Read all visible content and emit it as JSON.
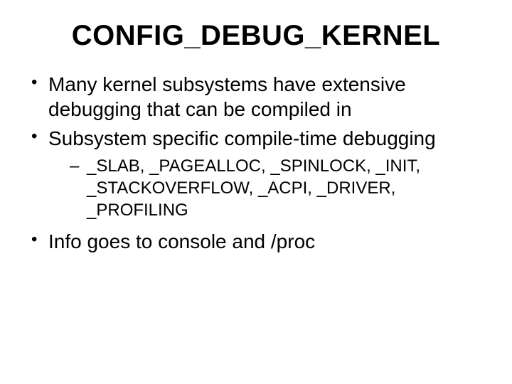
{
  "title": "CONFIG_DEBUG_KERNEL",
  "bullets": {
    "b1": "Many kernel subsystems have extensive debugging that can be compiled in",
    "b2": "Subsystem specific compile-time debugging",
    "b2_sub1": "_SLAB, _PAGEALLOC, _SPINLOCK, _INIT, _STACKOVERFLOW, _ACPI, _DRIVER, _PROFILING",
    "b3": "Info goes to console and /proc"
  }
}
